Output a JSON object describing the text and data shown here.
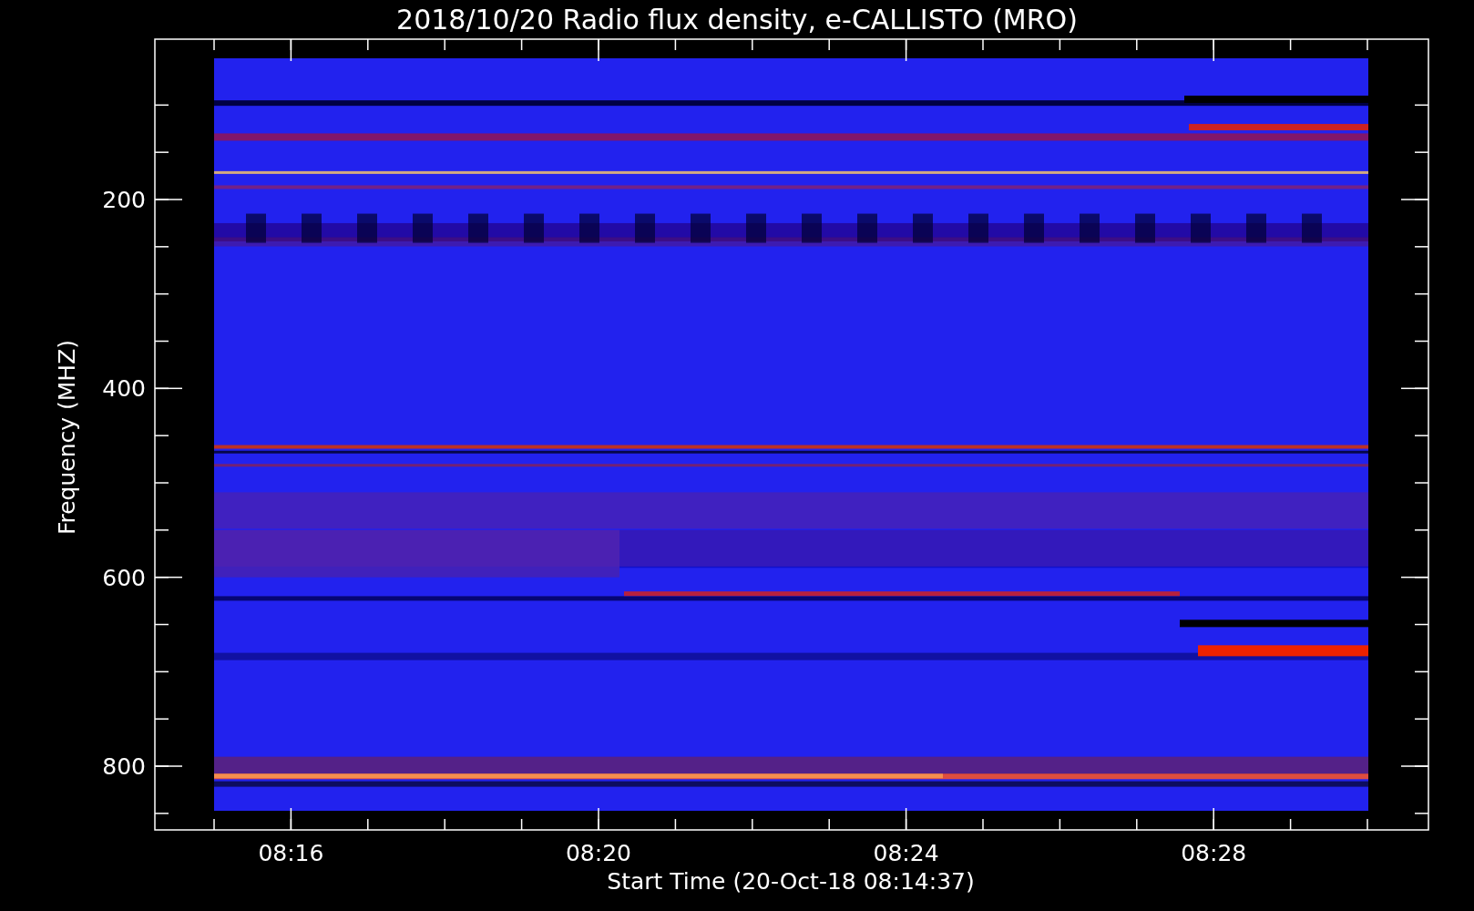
{
  "title": "2018/10/20  Radio flux density, e-CALLISTO (MRO)",
  "y_axis": {
    "label": "Frequency (MHZ)",
    "ticks": [
      "200",
      "400",
      "600",
      "800"
    ]
  },
  "x_axis": {
    "label": "Start Time (20-Oct-18 08:14:37)",
    "ticks": [
      "08:16",
      "08:20",
      "08:24",
      "08:28"
    ]
  }
}
